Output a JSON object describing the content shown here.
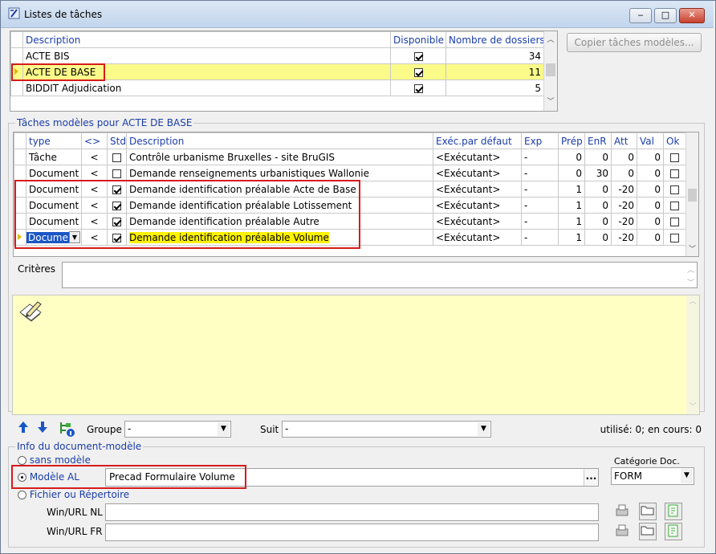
{
  "window": {
    "title": "Listes de tâches",
    "minimize_glyph": "‒",
    "maximize_glyph": "□",
    "close_glyph": "✕"
  },
  "task_lists": {
    "columns": [
      "Description",
      "Disponible",
      "Nombre de dossiers"
    ],
    "rows": [
      {
        "description": "ACTE BIS",
        "available": true,
        "count": "34"
      },
      {
        "description": "ACTE DE BASE",
        "available": true,
        "count": "11"
      },
      {
        "description": "BIDDIT Adjudication",
        "available": true,
        "count": "5"
      }
    ],
    "selected_index": 1
  },
  "copy_button": "Copier tâches modèles...",
  "models_section": {
    "title": "Tâches modèles pour ACTE DE BASE",
    "columns": [
      "type",
      "<>",
      "Std",
      "Description",
      "Exéc.par défaut",
      "Exp",
      "Prép",
      "EnR",
      "Att",
      "Val",
      "Ok"
    ],
    "rows": [
      {
        "type": "Tâche",
        "op": "<",
        "std": false,
        "description": "Contrôle urbanisme Bruxelles - site BruGIS",
        "executor": "<Exécutant>",
        "exp": "-",
        "prep": "0",
        "enr": "0",
        "att": "0",
        "val": "0",
        "ok": false
      },
      {
        "type": "Document",
        "op": "<",
        "std": false,
        "description": "Demande renseignements urbanistiques Wallonie",
        "executor": "<Exécutant>",
        "exp": "-",
        "prep": "0",
        "enr": "30",
        "att": "0",
        "val": "0",
        "ok": false
      },
      {
        "type": "Document",
        "op": "<",
        "std": true,
        "description": "Demande identification préalable Acte de Base",
        "executor": "<Exécutant>",
        "exp": "-",
        "prep": "1",
        "enr": "0",
        "att": "-20",
        "val": "0",
        "ok": false
      },
      {
        "type": "Document",
        "op": "<",
        "std": true,
        "description": "Demande identification préalable Lotissement",
        "executor": "<Exécutant>",
        "exp": "-",
        "prep": "1",
        "enr": "0",
        "att": "-20",
        "val": "0",
        "ok": false
      },
      {
        "type": "Document",
        "op": "<",
        "std": true,
        "description": "Demande identification préalable Autre",
        "executor": "<Exécutant>",
        "exp": "-",
        "prep": "1",
        "enr": "0",
        "att": "-20",
        "val": "0",
        "ok": false
      },
      {
        "type": "Docume",
        "op": "<",
        "std": true,
        "description": "Demande identification préalable Volume",
        "executor": "<Exécutant>",
        "exp": "-",
        "prep": "1",
        "enr": "0",
        "att": "-20",
        "val": "0",
        "ok": false
      }
    ],
    "selected_index": 5
  },
  "criteria_label": "Critères",
  "criteria_value": "",
  "toolbar": {
    "groupe_label": "Groupe",
    "groupe_value": "-",
    "suit_label": "Suit",
    "suit_value": "-",
    "status": "utilisé: 0; en cours: 0"
  },
  "doc_info": {
    "title": "Info du document-modèle",
    "option_none": "sans modèle",
    "option_model": "Modèle AL",
    "option_file": "Fichier ou Répertoire",
    "selected_option": "model",
    "model_value": "Precad Formulaire Volume",
    "ellipsis": "...",
    "category_label": "Catégorie Doc.",
    "category_value": "FORM",
    "win_nl_label": "Win/URL NL",
    "win_fr_label": "Win/URL FR",
    "win_nl_value": "",
    "win_fr_value": ""
  },
  "colors": {
    "selection_yellow": "#fbfb8a",
    "note_area": "#ffffc4",
    "highlight_red": "#d61b1b",
    "header_blue": "#1a3da8"
  }
}
